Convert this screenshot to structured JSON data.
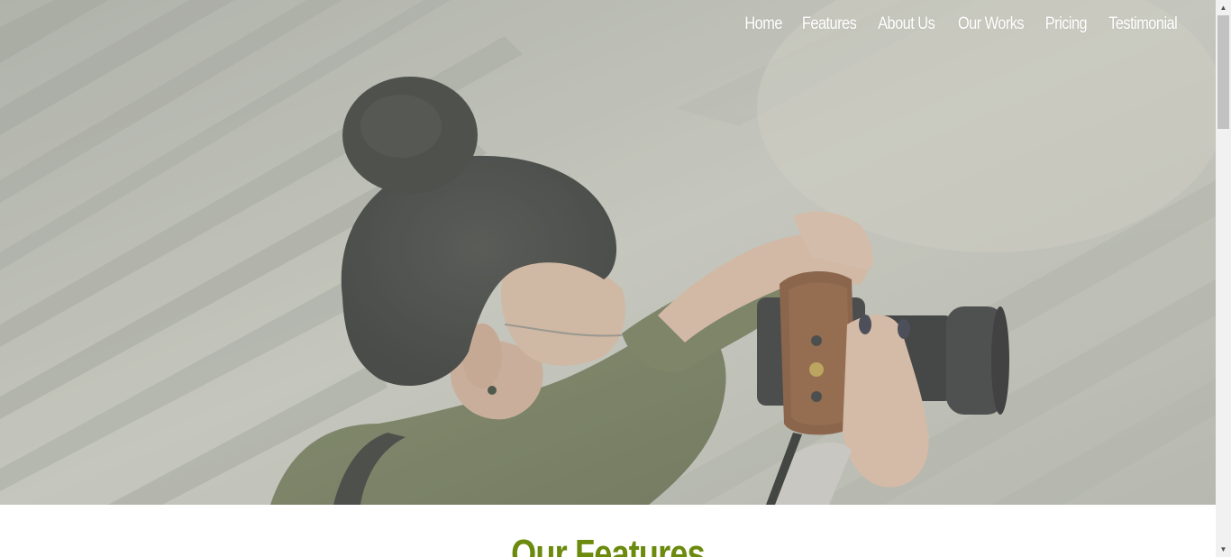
{
  "nav": {
    "items": [
      {
        "label": "Home"
      },
      {
        "label": "Features"
      },
      {
        "label": "About Us"
      },
      {
        "label": "Our Works"
      },
      {
        "label": "Pricing"
      },
      {
        "label": "Testimonial"
      }
    ]
  },
  "hero": {
    "image": "photographer-with-camera"
  },
  "features": {
    "title": "Our Features"
  },
  "scrollbar": {
    "up_icon": "chevron-up-icon",
    "down_icon": "chevron-down-icon",
    "position": 0
  },
  "colors": {
    "accent": "#6b8a0e",
    "nav_text": "#ffffff",
    "hero_overlay": "#c9cbc3",
    "scrollbar_track": "#f1f1f1",
    "scrollbar_thumb": "#c1c1c1"
  }
}
